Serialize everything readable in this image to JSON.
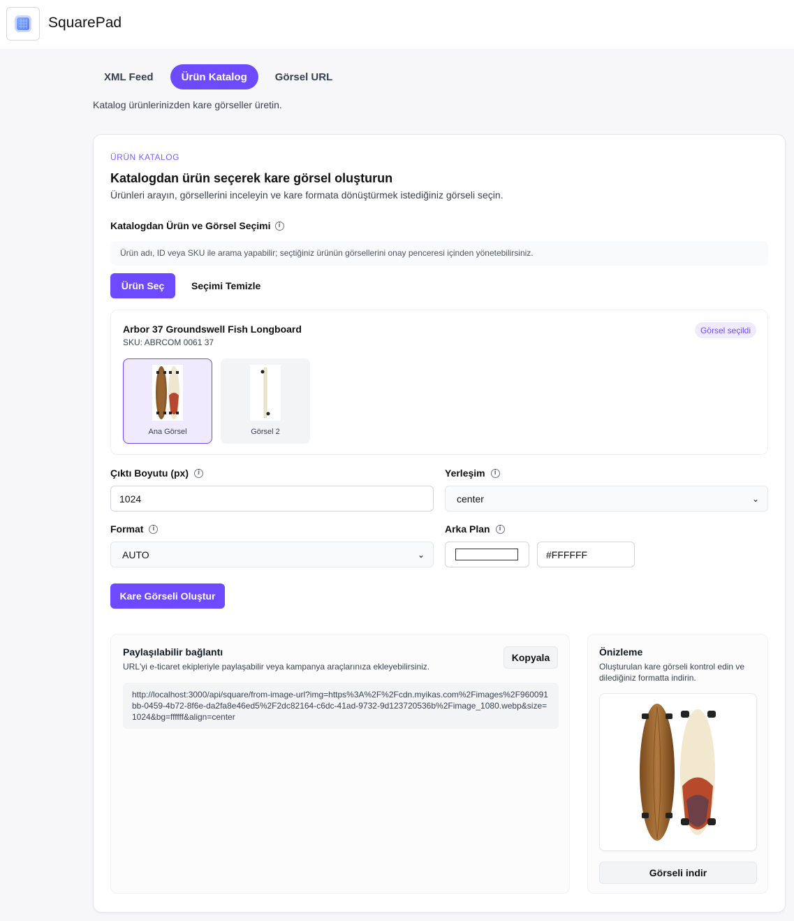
{
  "app": {
    "title": "SquarePad",
    "logo_icon": "app-logo-icon"
  },
  "tabs": [
    {
      "label": "XML Feed",
      "active": false
    },
    {
      "label": "Ürün Katalog",
      "active": true
    },
    {
      "label": "Görsel URL",
      "active": false
    }
  ],
  "page_subtitle": "Katalog ürünlerinizden kare görseller üretin.",
  "card": {
    "eyebrow": "ÜRÜN KATALOG",
    "title": "Katalogdan ürün seçerek kare görsel oluşturun",
    "description": "Ürünleri arayın, görsellerini inceleyin ve kare formata dönüştürmek istediğiniz görseli seçin."
  },
  "selection": {
    "label": "Katalogdan Ürün ve Görsel Seçimi",
    "hint": "Ürün adı, ID veya SKU ile arama yapabilir; seçtiğiniz ürünün görsellerini onay penceresi içinden yönetebilirsiniz.",
    "select_button": "Ürün Seç",
    "clear_button": "Seçimi Temizle"
  },
  "product": {
    "name": "Arbor 37 Groundswell Fish Longboard",
    "sku": "SKU: ABRCOM 0061 37",
    "badge": "Görsel seçildi",
    "images": [
      {
        "label": "Ana Görsel",
        "selected": true
      },
      {
        "label": "Görsel 2",
        "selected": false
      }
    ]
  },
  "settings": {
    "output_size": {
      "label": "Çıktı Boyutu (px)",
      "value": "1024"
    },
    "placement": {
      "label": "Yerleşim",
      "value": "center"
    },
    "format": {
      "label": "Format",
      "value": "AUTO"
    },
    "background": {
      "label": "Arka Plan",
      "value": "#FFFFFF",
      "color": "#FFFFFF"
    }
  },
  "generate_button": "Kare Görseli Oluştur",
  "share": {
    "title": "Paylaşılabilir bağlantı",
    "description": "URL'yi e-ticaret ekipleriyle paylaşabilir veya kampanya araçlarınıza ekleyebilirsiniz.",
    "copy_button": "Kopyala",
    "url": "http://localhost:3000/api/square/from-image-url?img=https%3A%2F%2Fcdn.myikas.com%2Fimages%2F960091bb-0459-4b72-8f6e-da2fa8e46ed5%2F2dc82164-c6dc-41ad-9732-9d123720536b%2Fimage_1080.webp&size=1024&bg=ffffff&align=center"
  },
  "preview": {
    "title": "Önizleme",
    "description": "Oluşturulan kare görseli kontrol edin ve dilediğiniz formatta indirin.",
    "download_button": "Görseli indir"
  },
  "colors": {
    "accent": "#6d4aff",
    "accent_soft": "#efeafe"
  }
}
